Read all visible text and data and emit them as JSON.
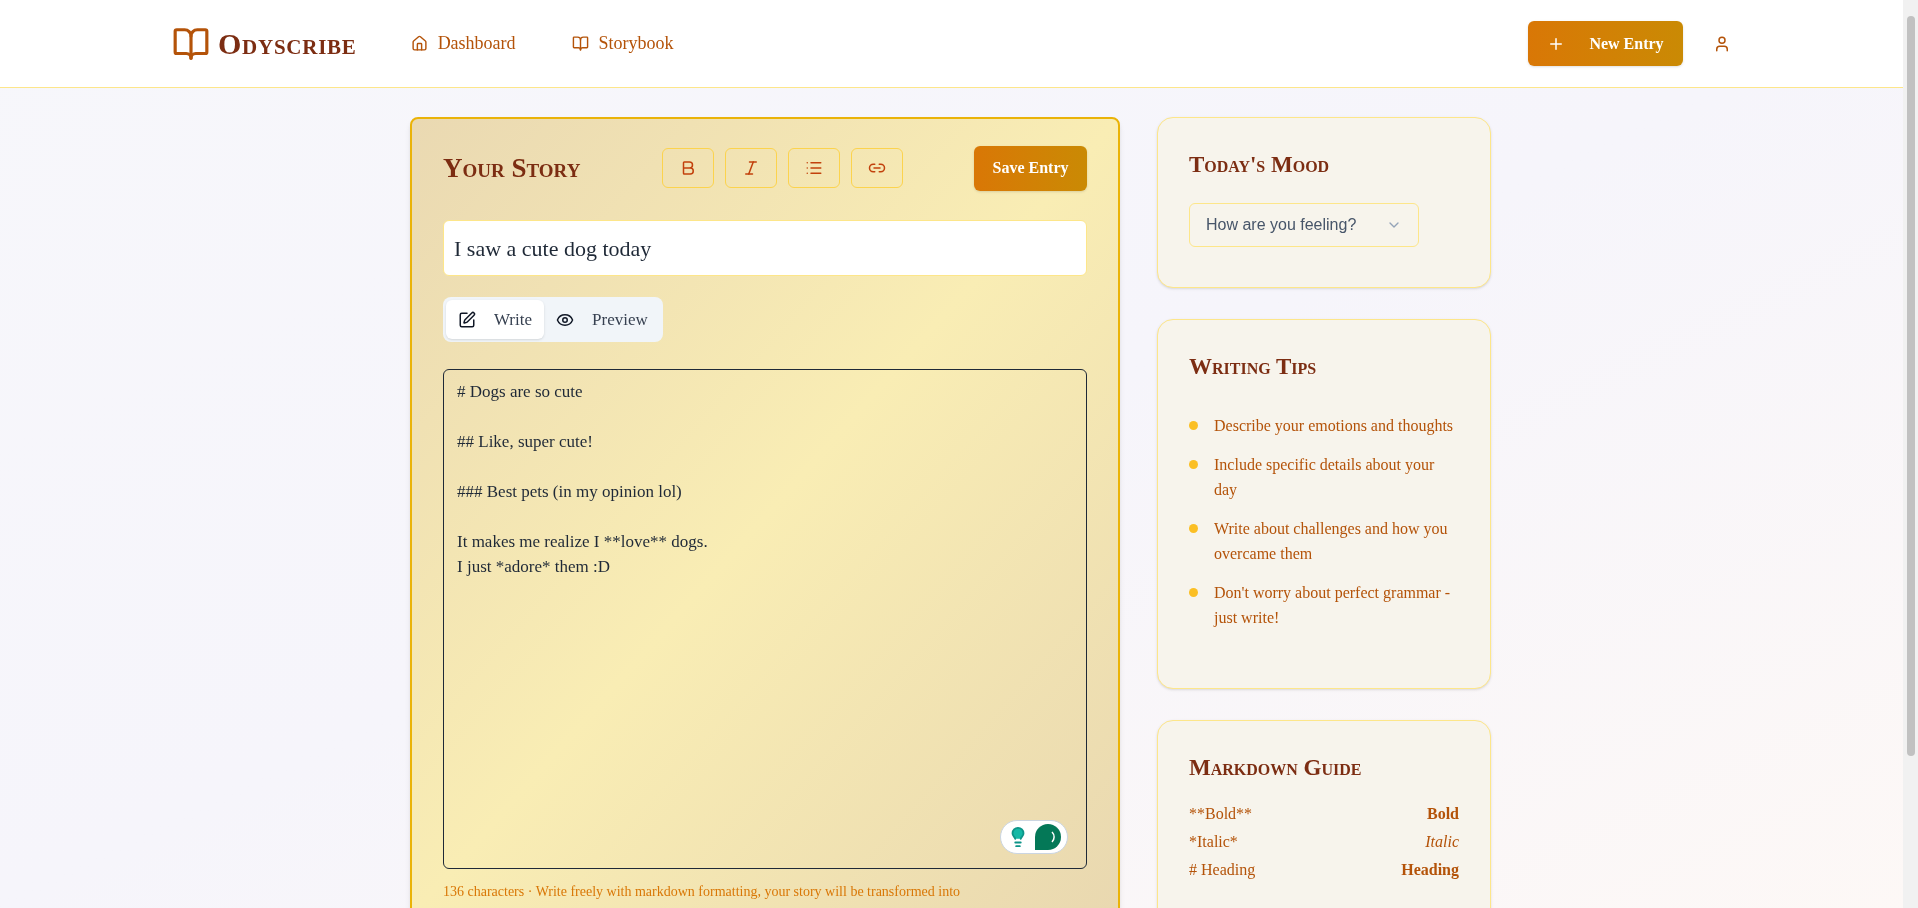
{
  "header": {
    "logo": "Odyscribe",
    "nav": [
      {
        "label": "Dashboard",
        "kind": "home"
      },
      {
        "label": "Storybook",
        "kind": "book"
      }
    ],
    "new_entry_button": "New Entry"
  },
  "editor": {
    "title": "Your Story",
    "toolbar": [
      {
        "kind": "bold"
      },
      {
        "kind": "italic"
      },
      {
        "kind": "list"
      },
      {
        "kind": "link"
      }
    ],
    "save_button": "Save Entry",
    "entry_title": "I saw a cute dog today",
    "tabs": [
      {
        "label": "Write",
        "kind": "edit",
        "selected": true
      },
      {
        "label": "Preview",
        "kind": "eye",
        "selected": false
      }
    ],
    "content": "# Dogs are so cute\n\n## Like, super cute!\n\n### Best pets (in my opinion lol)\n\nIt makes me realize I **love** dogs.\nI just *adore* them :D",
    "footer": "136 characters · Write freely with markdown formatting, your story will be transformed into"
  },
  "mood": {
    "title": "Today's Mood",
    "select_placeholder": "How are you feeling?"
  },
  "tips": {
    "title": "Writing Tips",
    "items": [
      "Describe your emotions and thoughts",
      "Include specific details about your day",
      "Write about challenges and how you overcame them",
      "Don't worry about perfect grammar - just write!"
    ]
  },
  "guide": {
    "title": "Markdown Guide",
    "rows": [
      {
        "syntax": "**Bold**",
        "result": "Bold",
        "kind": "bold"
      },
      {
        "syntax": "*Italic*",
        "result": "Italic",
        "kind": "italic"
      },
      {
        "syntax": "# Heading",
        "result": "Heading",
        "kind": "heading"
      }
    ]
  }
}
